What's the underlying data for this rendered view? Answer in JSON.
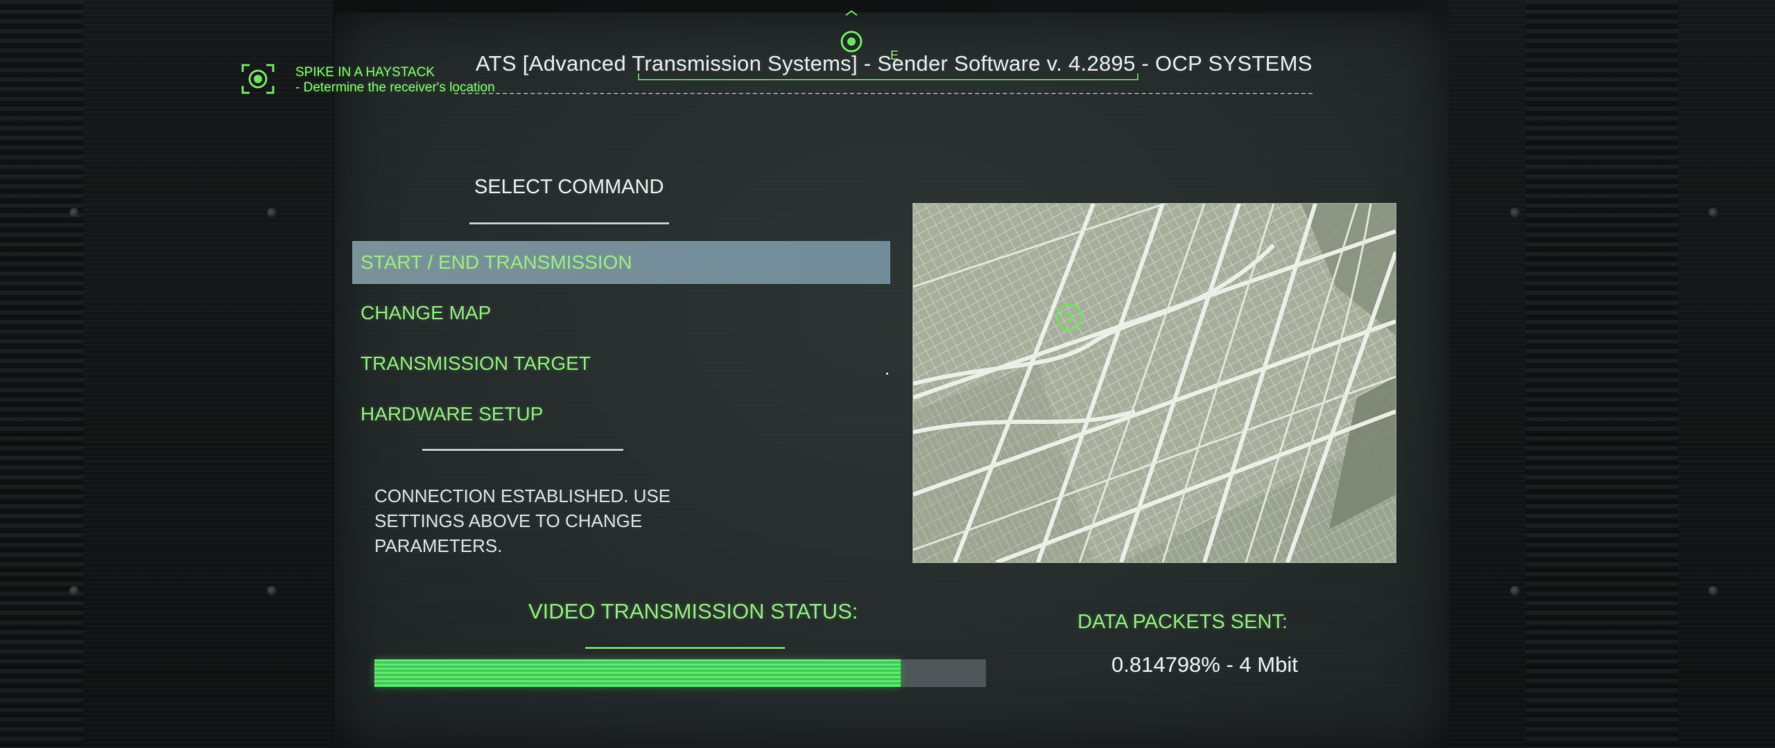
{
  "objective": {
    "title": "SPIKE IN A HAYSTACK",
    "description": "- Determine the receiver's location",
    "icon": "target-scan-icon"
  },
  "compass": {
    "letter": "E",
    "marker_icon": "waypoint-marker-icon"
  },
  "window": {
    "title": "ATS [Advanced Transmission Systems] - Sender Software v. 4.2895 - OCP SYSTEMS"
  },
  "menu": {
    "heading": "SELECT COMMAND",
    "items": [
      {
        "label": "START / END TRANSMISSION",
        "selected": true
      },
      {
        "label": "CHANGE MAP",
        "selected": false
      },
      {
        "label": "TRANSMISSION TARGET",
        "selected": false
      },
      {
        "label": "HARDWARE SETUP",
        "selected": false
      }
    ]
  },
  "status": {
    "message": "CONNECTION ESTABLISHED. USE SETTINGS ABOVE TO CHANGE PARAMETERS."
  },
  "transmission": {
    "label": "VIDEO TRANSMISSION STATUS:",
    "progress_fraction": 0.86
  },
  "packets": {
    "label": "DATA PACKETS SENT:",
    "value": "0.814798% - 4 Mbit"
  },
  "colors": {
    "accent_green": "#8fe57e",
    "hud_green": "#7ef06a",
    "selection_bg": "#7f98a0",
    "progress_fill": "#5ee86c",
    "map_bg": "#8f9886"
  }
}
